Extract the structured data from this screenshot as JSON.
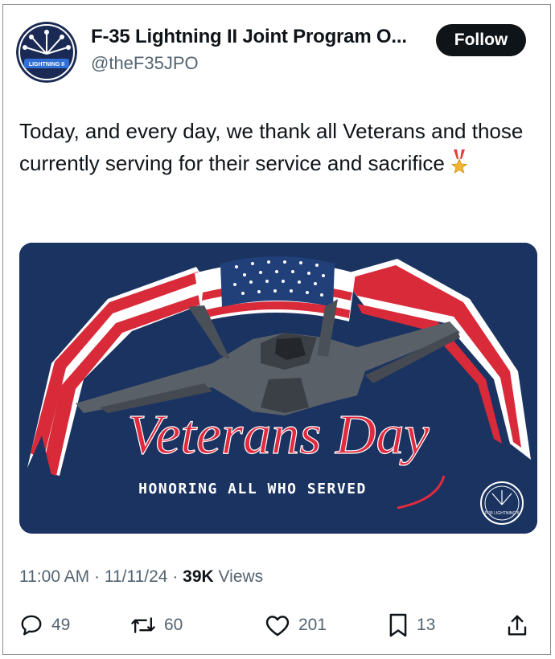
{
  "account": {
    "display_name": "F-35 Lightning II Joint Program O...",
    "handle": "@theF35JPO",
    "avatar_text": "LIGHTNING II"
  },
  "follow_label": "Follow",
  "tweet": {
    "text": "Today, and every day, we thank all Veterans and those currently serving for their service and sacrifice",
    "emoji": "military-medal-icon"
  },
  "media": {
    "headline": "Veterans Day",
    "subline": "HONORING ALL WHO SERVED",
    "badge_text": "F-35 LIGHTNING II"
  },
  "meta": {
    "time": "11:00 AM",
    "date": "11/11/24",
    "views_count": "39K",
    "views_label": "Views"
  },
  "actions": {
    "replies": "49",
    "reposts": "60",
    "likes": "201",
    "bookmarks": "13"
  },
  "colors": {
    "navy": "#1b3361",
    "red": "#d92a3a",
    "text": "#0f1419",
    "muted": "#536471"
  }
}
